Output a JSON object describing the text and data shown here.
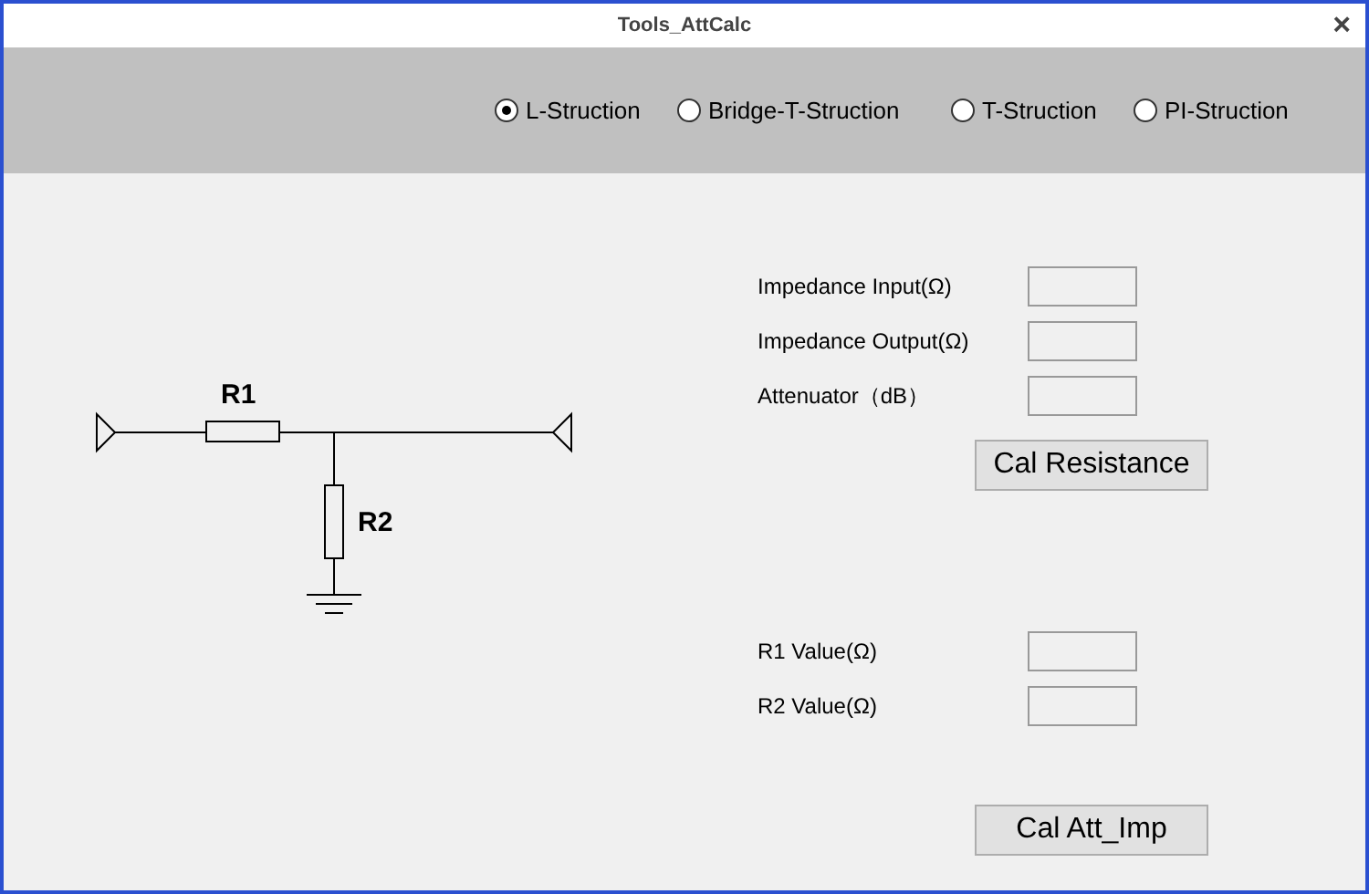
{
  "window": {
    "title": "Tools_AttCalc",
    "close": "×"
  },
  "structures": [
    {
      "label": "L-Struction",
      "selected": true
    },
    {
      "label": "Bridge-T-Struction",
      "selected": false
    },
    {
      "label": "T-Struction",
      "selected": false
    },
    {
      "label": "PI-Struction",
      "selected": false
    }
  ],
  "schematic": {
    "labels": [
      "R1",
      "R2"
    ]
  },
  "inputs": [
    {
      "label": "Impedance Input(Ω)"
    },
    {
      "label": "Impedance Output(Ω)"
    },
    {
      "label": "Attenuator（dB）"
    }
  ],
  "calc_button": "Cal Resistance",
  "outputs": [
    {
      "label": "R1 Value(Ω)"
    },
    {
      "label": "R2 Value(Ω)"
    }
  ],
  "reverse_button": "Cal Att_Imp"
}
